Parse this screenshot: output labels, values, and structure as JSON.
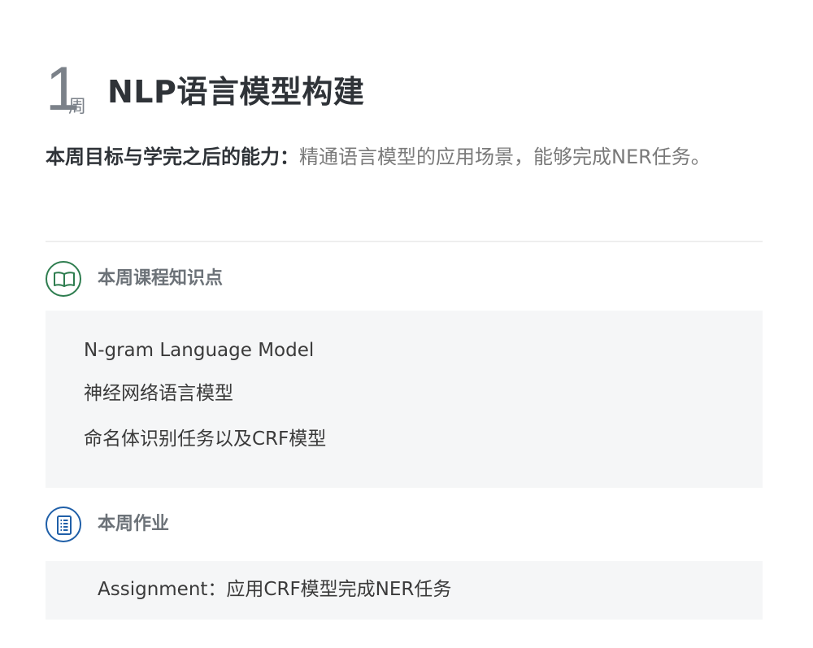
{
  "week": {
    "number": "1",
    "unit": "周",
    "title": "NLP语言模型构建"
  },
  "goal": {
    "label": "本周目标与学完之后的能力：",
    "text": "精通语言模型的应用场景，能够完成NER任务。"
  },
  "knowledge": {
    "title": "本周课程知识点",
    "icon": "book-icon",
    "items": [
      "N-gram Language Model",
      "神经网络语言模型",
      "命名体识别任务以及CRF模型"
    ]
  },
  "homework": {
    "title": "本周作业",
    "icon": "document-list-icon",
    "text": "Assignment：应用CRF模型完成NER任务"
  },
  "colors": {
    "knowledge_icon": "#2e7d4f",
    "homework_icon": "#1f5fa8",
    "panel_bg": "#f5f6f7"
  }
}
